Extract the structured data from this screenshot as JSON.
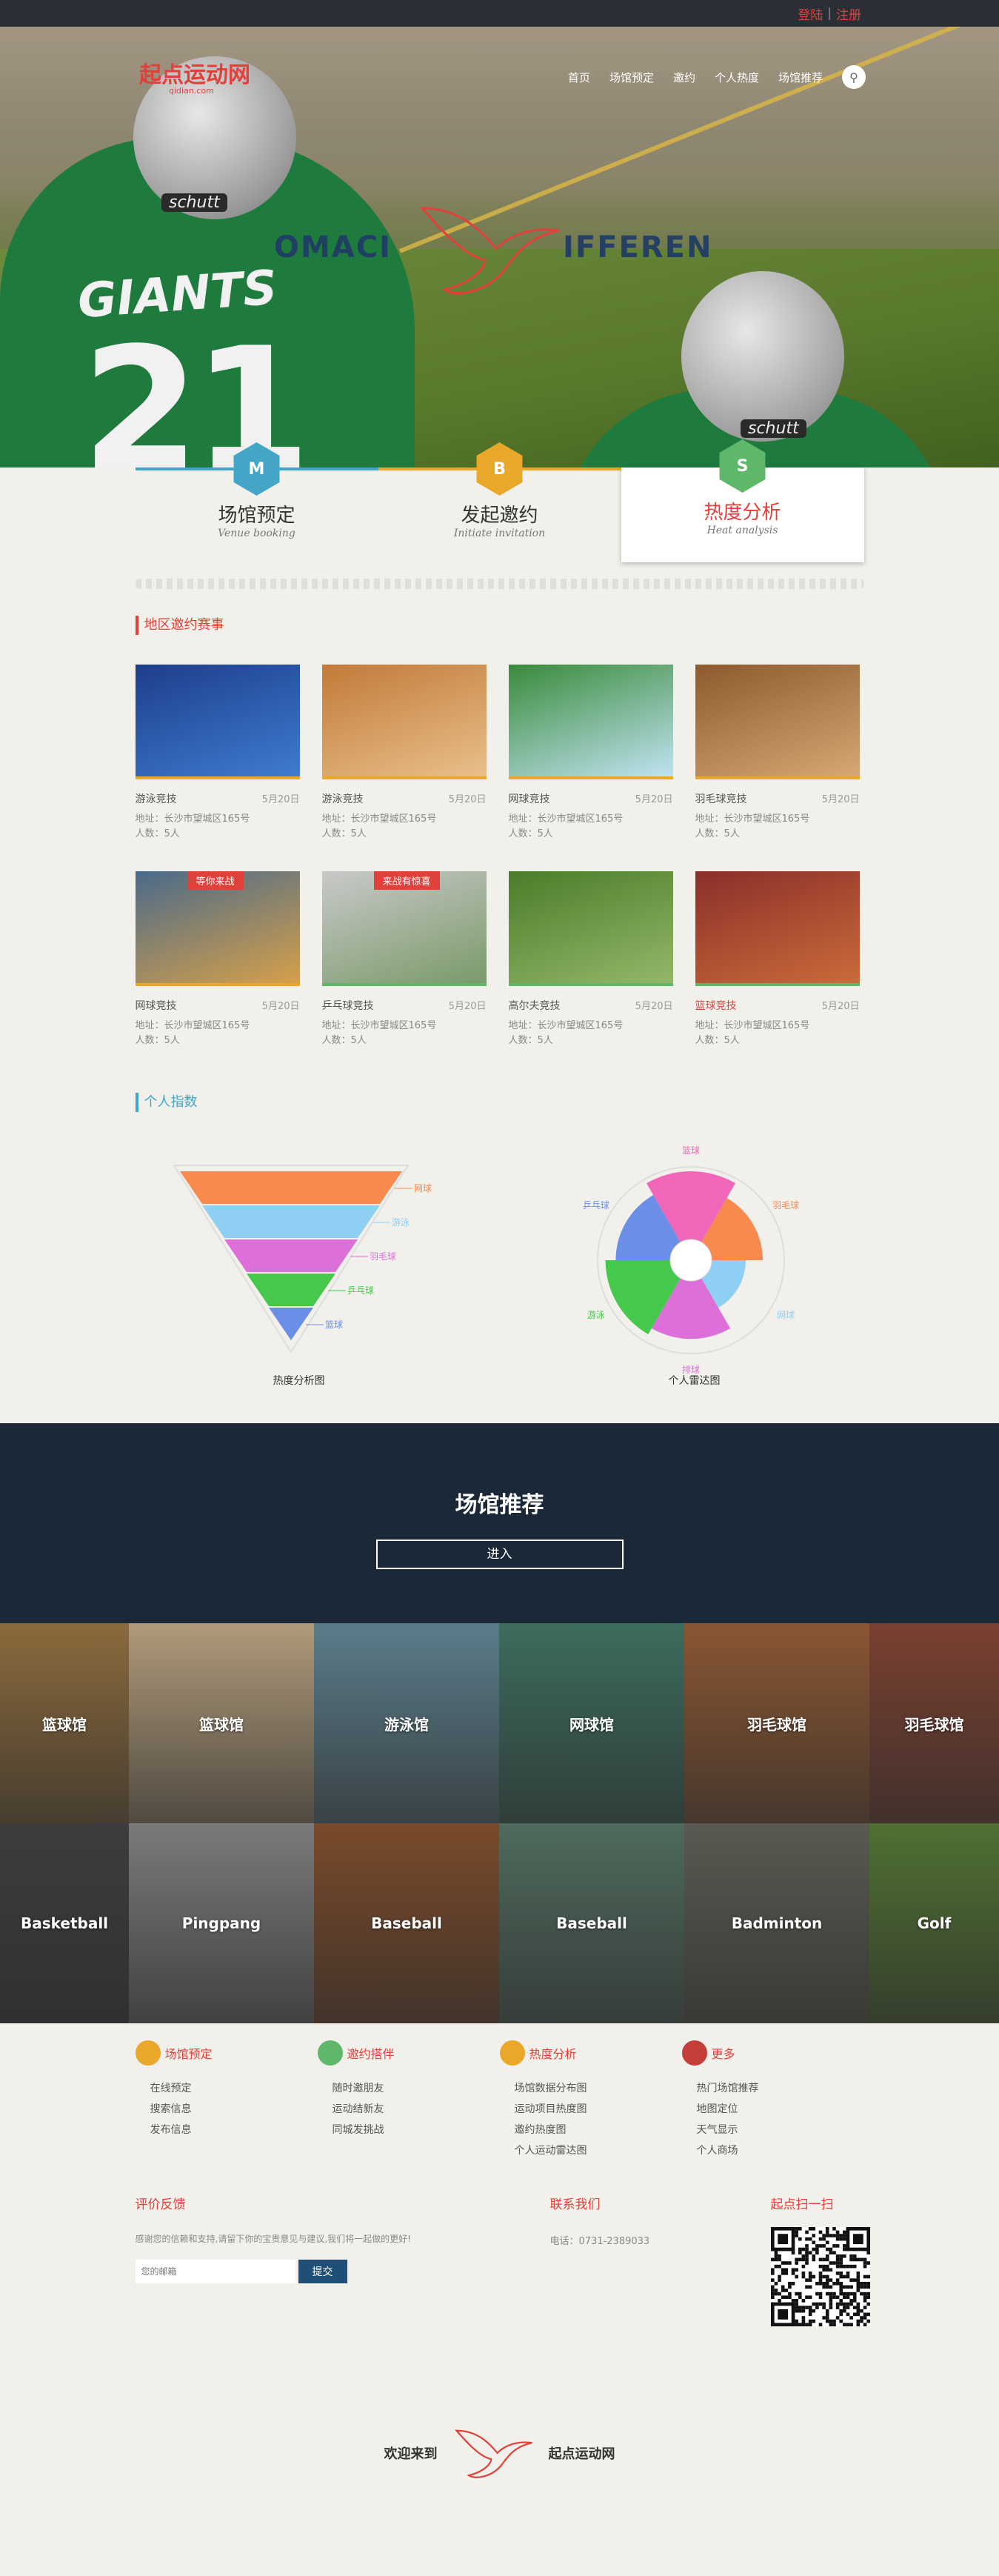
{
  "topbar": {
    "login": "登陆",
    "register": "注册"
  },
  "brand": {
    "name": "起点运动网",
    "sub": "qidian.com"
  },
  "nav": {
    "items": [
      "首页",
      "场馆预定",
      "邀约",
      "个人热度",
      "场馆推荐"
    ],
    "search_icon": "search-icon"
  },
  "hero": {
    "text_left": "OMACI",
    "text_right": "IFFEREN",
    "jersey_name": "GIANTS",
    "jersey_number": "21",
    "helmet_brand": "schutt"
  },
  "features": [
    {
      "letter": "M",
      "title": "场馆预定",
      "subtitle": "Venue booking",
      "color": "#44a6c6"
    },
    {
      "letter": "B",
      "title": "发起邀约",
      "subtitle": "Initiate invitation",
      "color": "#e9a82a"
    },
    {
      "letter": "S",
      "title": "热度分析",
      "subtitle": "Heat analysis",
      "color": "#5fb86a"
    }
  ],
  "events_heading": "地区邀约赛事",
  "events": [
    {
      "name": "游泳竞技",
      "date": "5月20日",
      "address": "地址：长沙市望城区165号",
      "people": "人数：5人",
      "ribbon": ""
    },
    {
      "name": "游泳竞技",
      "date": "5月20日",
      "address": "地址：长沙市望城区165号",
      "people": "人数：5人",
      "ribbon": ""
    },
    {
      "name": "网球竞技",
      "date": "5月20日",
      "address": "地址：长沙市望城区165号",
      "people": "人数：5人",
      "ribbon": ""
    },
    {
      "name": "羽毛球竞技",
      "date": "5月20日",
      "address": "地址：长沙市望城区165号",
      "people": "人数：5人",
      "ribbon": ""
    },
    {
      "name": "网球竞技",
      "date": "5月20日",
      "address": "地址：长沙市望城区165号",
      "people": "人数：5人",
      "ribbon": "等你来战"
    },
    {
      "name": "乒乓球竞技",
      "date": "5月20日",
      "address": "地址：长沙市望城区165号",
      "people": "人数：5人",
      "ribbon": "来战有惊喜"
    },
    {
      "name": "高尔夫竞技",
      "date": "5月20日",
      "address": "地址：长沙市望城区165号",
      "people": "人数：5人",
      "ribbon": ""
    },
    {
      "name": "篮球竞技",
      "date": "5月20日",
      "address": "地址：长沙市望城区165号",
      "people": "人数：5人",
      "ribbon": ""
    }
  ],
  "personal_heading": "个人指数",
  "chart_data": [
    {
      "type": "funnel",
      "title": "热度分析图",
      "categories": [
        "网球",
        "游泳",
        "羽毛球",
        "乒乓球",
        "篮球"
      ],
      "values": [
        100,
        80,
        60,
        40,
        20
      ],
      "colors": [
        "#f78a4f",
        "#8ecff3",
        "#dd6fd8",
        "#46c84c",
        "#6b8fe6"
      ]
    },
    {
      "type": "radar",
      "title": "个人雷达图",
      "categories": [
        "羽毛球",
        "网球",
        "排球",
        "游泳",
        "乒乓球",
        "篮球"
      ],
      "values": [
        75,
        50,
        85,
        95,
        80,
        100
      ],
      "colors": [
        "#f78a4f",
        "#8ecff3",
        "#dd6fd8",
        "#46c84c",
        "#6b8fe6",
        "#f066b8"
      ]
    }
  ],
  "recommend": {
    "title": "场馆推荐",
    "enter": "进入"
  },
  "venues": [
    {
      "label": "篮球馆",
      "color": "#8b6a3c"
    },
    {
      "label": "篮球馆",
      "color": "#b09a7a"
    },
    {
      "label": "游泳馆",
      "color": "#5b7c8a"
    },
    {
      "label": "网球馆",
      "color": "#3c6c5e"
    },
    {
      "label": "羽毛球馆",
      "color": "#8a5632"
    },
    {
      "label": "羽毛球馆",
      "color": "#7a4030"
    },
    {
      "label": "Basketball",
      "color": "#3d3d3d"
    },
    {
      "label": "Pingpang",
      "color": "#7a7a7c"
    },
    {
      "label": "Baseball",
      "color": "#7a4a2a"
    },
    {
      "label": "Baseball",
      "color": "#4f6a5d"
    },
    {
      "label": "Badminton",
      "color": "#5a5a52"
    },
    {
      "label": "Golf",
      "color": "#4f7032"
    }
  ],
  "footer": {
    "cols": [
      {
        "title": "场馆预定",
        "items": [
          "在线预定",
          "搜索信息",
          "发布信息"
        ],
        "icon_color": "#e9a82a"
      },
      {
        "title": "邀约搭伴",
        "items": [
          "随时邀朋友",
          "运动结新友",
          "同城发挑战"
        ],
        "icon_color": "#5fb86a"
      },
      {
        "title": "热度分析",
        "items": [
          "场馆数据分布图",
          "运动项目热度图",
          "邀约热度图",
          "个人运动雷达图"
        ],
        "icon_color": "#e9a82a"
      },
      {
        "title": "更多",
        "items": [
          "热门场馆推荐",
          "地图定位",
          "天气显示",
          "个人商场"
        ],
        "icon_color": "#c43e3a"
      }
    ],
    "feedback": {
      "title": "评价反馈",
      "text": "感谢您的信赖和支持,请留下你的宝贵意见与建议,我们将一起做的更好!",
      "placeholder": "您的邮箱",
      "submit": "提交"
    },
    "contact": {
      "title": "联系我们",
      "phone": "电话：0731-2389033"
    },
    "qr": {
      "title": "起点扫一扫"
    },
    "welcome": {
      "left": "欢迎来到",
      "right": "起点运动网"
    }
  }
}
